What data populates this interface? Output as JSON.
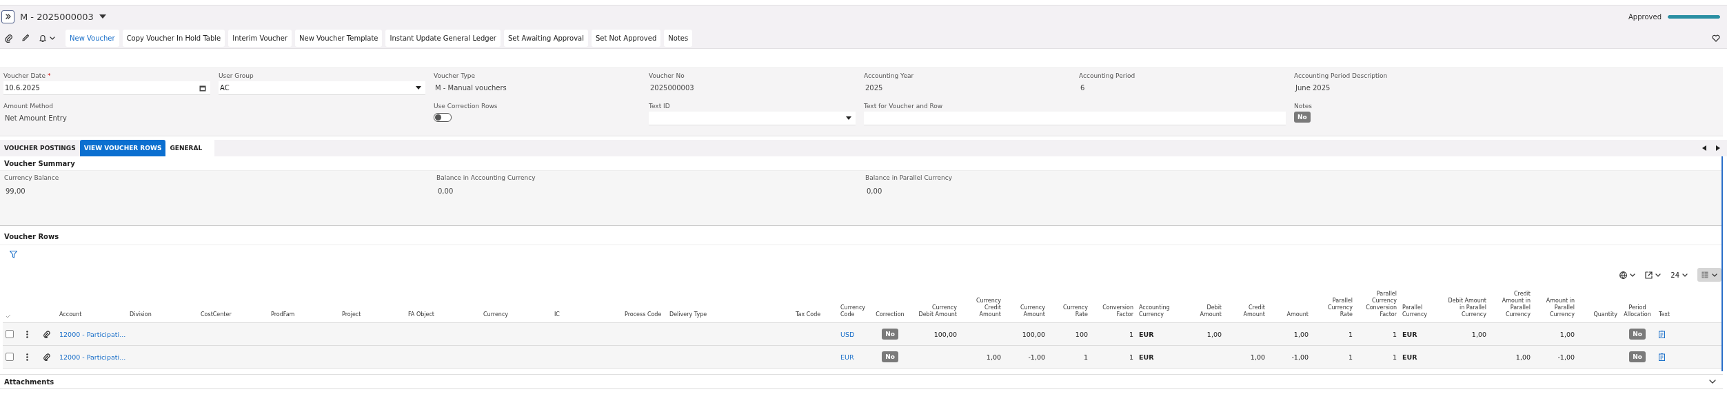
{
  "header": {
    "title": "M - 2025000003",
    "status": {
      "label": "Approved",
      "level": 1
    }
  },
  "toolbar": {
    "buttons": [
      {
        "label": "New Voucher",
        "primary": true
      },
      {
        "label": "Copy Voucher In Hold Table",
        "primary": false
      },
      {
        "label": "Interim Voucher",
        "primary": false
      },
      {
        "label": "New Voucher Template",
        "primary": false
      },
      {
        "label": "Instant Update General Ledger",
        "primary": false
      },
      {
        "label": "Set Awaiting Approval",
        "primary": false
      },
      {
        "label": "Set Not Approved",
        "primary": false
      },
      {
        "label": "Notes",
        "primary": false
      }
    ]
  },
  "form": {
    "fields": [
      {
        "label": "Voucher Date",
        "required_mark": "*",
        "kind": "date",
        "value": "10.6.2025"
      },
      {
        "label": "User Group",
        "kind": "select",
        "value": "AC"
      },
      {
        "label": "Voucher Type",
        "kind": "readonly",
        "value": "M - Manual vouchers"
      },
      {
        "label": "Voucher No",
        "kind": "readonly",
        "value": "2025000003"
      },
      {
        "label": "Accounting Year",
        "kind": "readonly",
        "value": "2025"
      },
      {
        "label": "Accounting Period",
        "kind": "readonly",
        "value": "6"
      },
      {
        "label": "Accounting Period Description",
        "kind": "readonly",
        "value": "June 2025"
      },
      {
        "label": "Amount Method",
        "kind": "readonly",
        "value": "Net Amount Entry"
      },
      {
        "label": "Use Correction Rows",
        "kind": "toggle",
        "on": false
      },
      {
        "label": "Text ID",
        "kind": "select"
      },
      {
        "label": "Text for Voucher and Row",
        "kind": "input"
      },
      {
        "label": "Notes",
        "kind": "badge",
        "value": "No"
      }
    ]
  },
  "tabs": [
    {
      "label": "VOUCHER POSTINGS",
      "selected": false
    },
    {
      "label": "VIEW VOUCHER ROWS",
      "selected": true
    },
    {
      "label": "GENERAL",
      "selected": false
    }
  ],
  "voucher_summary": {
    "title": "Voucher Summary",
    "items": [
      {
        "label": "Currency Balance",
        "value": "99,00"
      },
      {
        "label": "Balance in Accounting Currency",
        "value": "0,00"
      },
      {
        "label": "Balance in Parallel Currency",
        "value": "0,00"
      }
    ]
  },
  "voucher_rows": {
    "title": "Voucher Rows",
    "page_size": "24",
    "columns": [
      {
        "label": "Account",
        "kind": "link"
      },
      {
        "label": "Division",
        "kind": "text"
      },
      {
        "label": "CostCenter",
        "kind": "text"
      },
      {
        "label": "ProdFam",
        "kind": "text"
      },
      {
        "label": "Project",
        "kind": "text"
      },
      {
        "label": "FA Object",
        "kind": "text"
      },
      {
        "label": "Currency",
        "kind": "text"
      },
      {
        "label": "IC",
        "kind": "text"
      },
      {
        "label": "Process Code",
        "kind": "text"
      },
      {
        "label": "Delivery Type",
        "kind": "text"
      },
      {
        "label": "Tax Code",
        "kind": "text"
      },
      {
        "label": "Currency Code",
        "kind": "link"
      },
      {
        "label": "Correction",
        "kind": "badge"
      },
      {
        "label": "Currency Debit Amount",
        "kind": "number"
      },
      {
        "label": "Currency Credit Amount",
        "kind": "number"
      },
      {
        "label": "Currency Amount",
        "kind": "number"
      },
      {
        "label": "Currency Rate",
        "kind": "number"
      },
      {
        "label": "Conversion Factor",
        "kind": "number"
      },
      {
        "label": "Accounting Currency",
        "kind": "code"
      },
      {
        "label": "Debit Amount",
        "kind": "number"
      },
      {
        "label": "Credit Amount",
        "kind": "number"
      },
      {
        "label": "Amount",
        "kind": "number"
      },
      {
        "label": "Parallel Currency Rate",
        "kind": "number"
      },
      {
        "label": "Parallel Currency Conversion Factor",
        "kind": "number"
      },
      {
        "label": "Parallel Currency",
        "kind": "code"
      },
      {
        "label": "Debit Amount in Parallel Currency",
        "kind": "number"
      },
      {
        "label": "Credit Amount in Parallel Currency",
        "kind": "number"
      },
      {
        "label": "Amount in Parallel Currency",
        "kind": "number"
      },
      {
        "label": "Quantity",
        "kind": "number"
      },
      {
        "label": "Period Allocation",
        "kind": "badge"
      },
      {
        "label": "Text",
        "kind": "icon"
      }
    ],
    "rows": [
      {
        "selected": false,
        "cells": [
          "12000 - Participati...",
          null,
          null,
          null,
          null,
          null,
          null,
          null,
          null,
          null,
          null,
          "USD",
          "No",
          "100,00",
          null,
          "100,00",
          "100",
          "1",
          "EUR",
          "1,00",
          null,
          "1,00",
          "1",
          "1",
          "EUR",
          "1,00",
          null,
          "1,00",
          null,
          "No",
          true
        ]
      },
      {
        "selected": false,
        "cells": [
          "12000 - Participati...",
          null,
          null,
          null,
          null,
          null,
          null,
          null,
          null,
          null,
          null,
          "EUR",
          "No",
          null,
          "1,00",
          "-1,00",
          "1",
          "1",
          "EUR",
          null,
          "1,00",
          "-1,00",
          "1",
          "1",
          "EUR",
          null,
          "1,00",
          "-1,00",
          null,
          "No",
          true
        ]
      }
    ]
  },
  "attachments": {
    "title": "Attachments",
    "expanded": false
  }
}
